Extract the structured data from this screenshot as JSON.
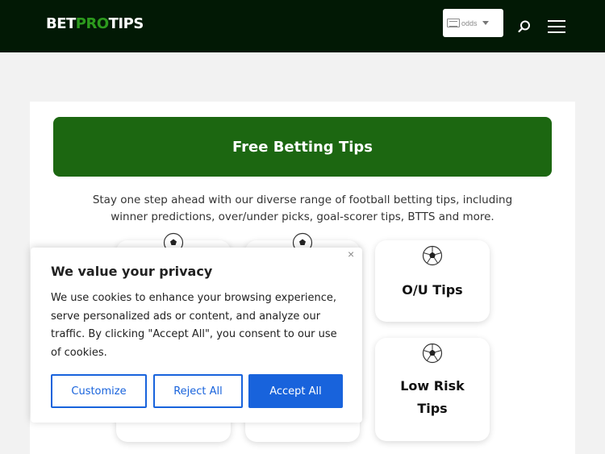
{
  "header": {
    "logo_part1": "BET",
    "logo_part2": "PRO",
    "logo_part3": "TIPS",
    "odds_label": "odds"
  },
  "hero": {
    "title": "Free Betting Tips"
  },
  "intro": {
    "text": "Stay one step ahead with our diverse range of football betting tips, including winner predictions, over/under picks, goal-scorer tips, BTTS and more."
  },
  "tiles": [
    {
      "name": "O/U Tips",
      "icon": "soccer-ball-icon"
    },
    {
      "name": "Low Risk Tips",
      "icon": "soccer-ball-icon"
    }
  ],
  "privacy": {
    "title": "We value your privacy",
    "body": "We use cookies to enhance your browsing experience, serve personalized ads or content, and analyze our traffic. By clicking \"Accept All\", you consent to our use of cookies.",
    "close": "×",
    "customize_label": "Customize",
    "reject_label": "Reject All",
    "accept_label": "Accept All"
  },
  "colors": {
    "header_bg": "#021905",
    "brand_green": "#2c9a1d",
    "hero_bg": "#1c6711",
    "accent_blue": "#1863dc"
  }
}
